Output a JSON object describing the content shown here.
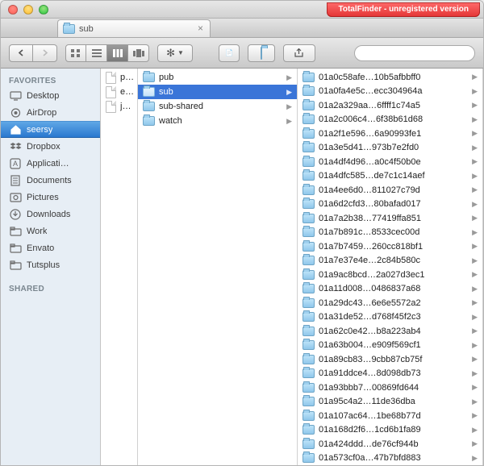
{
  "banner": "TotalFinder - unregistered version",
  "tab": {
    "title": "sub"
  },
  "sidebar": {
    "favorites_head": "FAVORITES",
    "shared_head": "SHARED",
    "items": [
      {
        "label": "Desktop",
        "icon": "desktop"
      },
      {
        "label": "AirDrop",
        "icon": "airdrop"
      },
      {
        "label": "seersy",
        "icon": "home",
        "selected": true
      },
      {
        "label": "Dropbox",
        "icon": "dropbox"
      },
      {
        "label": "Applicati…",
        "icon": "apps"
      },
      {
        "label": "Documents",
        "icon": "documents"
      },
      {
        "label": "Pictures",
        "icon": "pictures"
      },
      {
        "label": "Downloads",
        "icon": "downloads"
      },
      {
        "label": "Work",
        "icon": "folder"
      },
      {
        "label": "Envato",
        "icon": "folder"
      },
      {
        "label": "Tutsplus",
        "icon": "folder"
      }
    ]
  },
  "pane0": [
    {
      "label": "plist",
      "type": "doc"
    },
    {
      "label": "ent.db",
      "type": "doc"
    },
    {
      "label": "journal",
      "type": "doc"
    }
  ],
  "pane1": [
    {
      "label": "pub",
      "type": "folder",
      "chev": true
    },
    {
      "label": "sub",
      "type": "folder",
      "chev": true,
      "selected": true
    },
    {
      "label": "sub-shared",
      "type": "folder",
      "chev": true
    },
    {
      "label": "watch",
      "type": "folder",
      "chev": true
    }
  ],
  "pane2": [
    "01a0c58afe…10b5afbbff0",
    "01a0fa4e5c…ecc304964a",
    "01a2a329aa…6ffff1c74a5",
    "01a2c006c4…6f38b61d68",
    "01a2f1e596…6a90993fe1",
    "01a3e5d41…973b7e2fd0",
    "01a4df4d96…a0c4f50b0e",
    "01a4dfc585…de7c1c14aef",
    "01a4ee6d0…811027c79d",
    "01a6d2cfd3…80bafad017",
    "01a7a2b38…77419ffa851",
    "01a7b891c…8533cec00d",
    "01a7b7459…260cc818bf1",
    "01a7e37e4e…2c84b580c",
    "01a9ac8bcd…2a027d3ec1",
    "01a11d008…0486837a68",
    "01a29dc43…6e6e5572a2",
    "01a31de52…d768f45f2c3",
    "01a62c0e42…b8a223ab4",
    "01a63b004…e909f569cf1",
    "01a89cb83…9cbb87cb75f",
    "01a91ddce4…8d098db73",
    "01a93bbb7…00869fd644",
    "01a95c4a2…11de36dba",
    "01a107ac64…1be68b77d",
    "01a168d2f6…1cd6b1fa89",
    "01a424ddd…de76cf944b",
    "01a573cf0a…47b7bfd883"
  ]
}
